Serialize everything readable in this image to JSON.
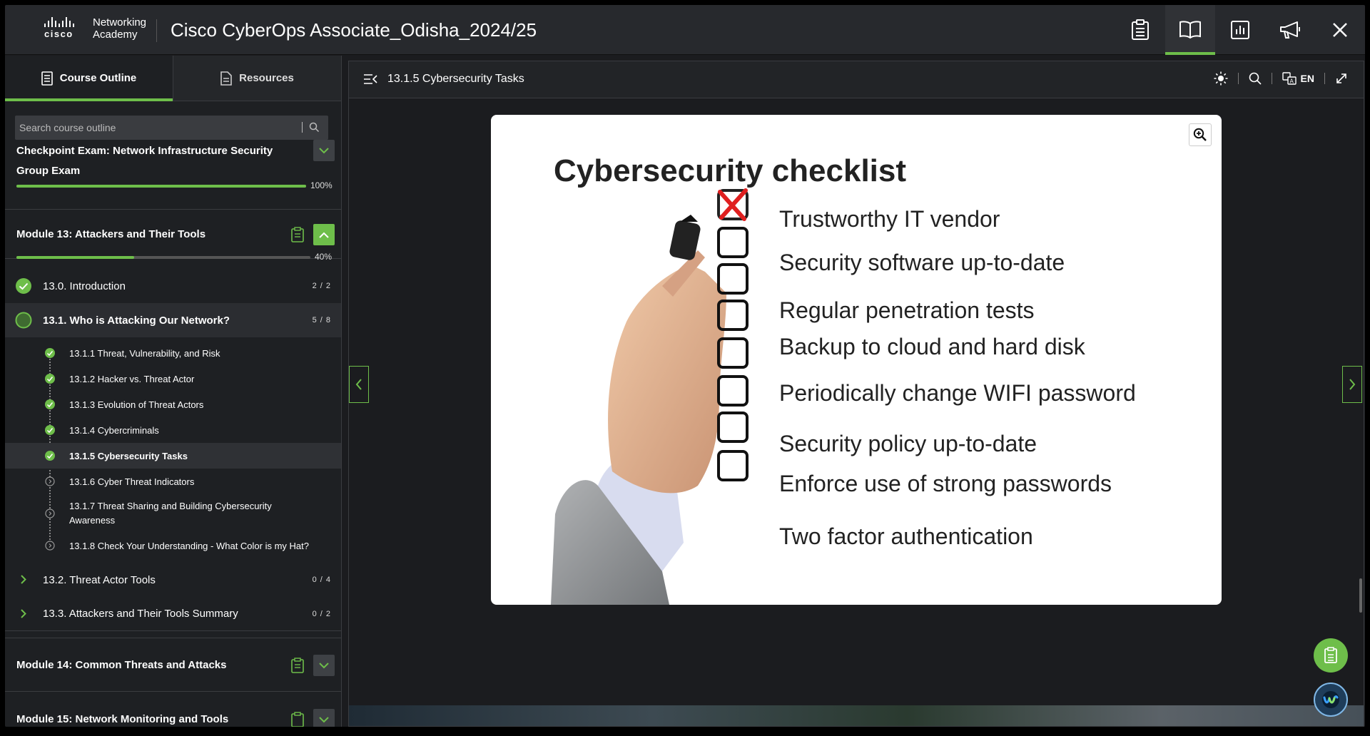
{
  "brand": {
    "logo_word": "cisco",
    "logo_line1": "Networking",
    "logo_line2": "Academy"
  },
  "course_title": "Cisco CyberOps Associate_Odisha_2024/25",
  "top_icons": [
    "clipboard-icon",
    "book-icon",
    "chart-icon",
    "megaphone-icon",
    "close-icon"
  ],
  "sidebar": {
    "tabs": [
      {
        "label": "Course Outline",
        "active": true
      },
      {
        "label": "Resources",
        "active": false
      }
    ],
    "search_placeholder": "Search course outline",
    "checkpoint": {
      "title": "Checkpoint Exam: Network Infrastructure Security Group Exam",
      "progress": 100,
      "progress_label": "100%"
    },
    "module13": {
      "title": "Module 13: Attackers and Their Tools",
      "progress": 40,
      "progress_label": "40%"
    },
    "lessons": [
      {
        "title": "13.0. Introduction",
        "count": "2 / 2",
        "status": "complete"
      },
      {
        "title": "13.1. Who is Attacking Our Network?",
        "count": "5 / 8",
        "status": "in-progress"
      },
      {
        "title": "13.2. Threat Actor Tools",
        "count": "0 / 4",
        "status": "collapsed"
      },
      {
        "title": "13.3. Attackers and Their Tools Summary",
        "count": "0 / 2",
        "status": "collapsed"
      }
    ],
    "topics": [
      {
        "title": "13.1.1 Threat, Vulnerability, and Risk",
        "done": true
      },
      {
        "title": "13.1.2 Hacker vs. Threat Actor",
        "done": true
      },
      {
        "title": "13.1.3 Evolution of Threat Actors",
        "done": true
      },
      {
        "title": "13.1.4 Cybercriminals",
        "done": true
      },
      {
        "title": "13.1.5 Cybersecurity Tasks",
        "done": true,
        "active": true
      },
      {
        "title": "13.1.6 Cyber Threat Indicators",
        "done": false
      },
      {
        "title": "13.1.7 Threat Sharing and Building Cybersecurity Awareness",
        "done": false
      },
      {
        "title": "13.1.8 Check Your Understanding - What Color is my Hat?",
        "done": false
      }
    ],
    "module14": {
      "title": "Module 14: Common Threats and Attacks"
    },
    "module15": {
      "title": "Module 15: Network Monitoring and Tools"
    }
  },
  "main": {
    "title": "13.1.5 Cybersecurity Tasks",
    "language": "EN",
    "slide": {
      "title": "Cybersecurity checklist",
      "items": [
        {
          "text": "Trustworthy IT vendor",
          "checked": true
        },
        {
          "text": "Security software up-to-date",
          "checked": false
        },
        {
          "text": "Regular penetration tests",
          "checked": false
        },
        {
          "text": "Backup to cloud and hard disk",
          "checked": false
        },
        {
          "text": "Periodically change WIFI password",
          "checked": false
        },
        {
          "text": "Security policy up-to-date",
          "checked": false
        },
        {
          "text": "Enforce use of strong passwords",
          "checked": false
        },
        {
          "text": "Two factor authentication",
          "checked": false
        }
      ]
    }
  },
  "colors": {
    "accent": "#6ebe4a",
    "topbar": "#27292d",
    "sidebar": "#1e2023",
    "main": "#1b1c1f",
    "check_red": "#e02020"
  }
}
